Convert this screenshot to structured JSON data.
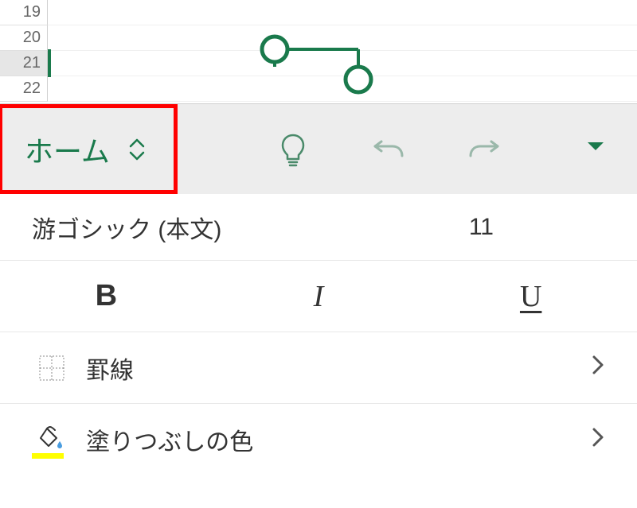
{
  "sheet": {
    "row_numbers": [
      "19",
      "20",
      "21",
      "22"
    ],
    "selected_row_index": 2
  },
  "toolbar": {
    "home_label": "ホーム",
    "icons": {
      "ideas": "lightbulb-icon",
      "undo": "undo-icon",
      "redo": "redo-icon",
      "expand": "dropdown-icon"
    }
  },
  "font": {
    "name": "游ゴシック (本文)",
    "size": "11"
  },
  "style_buttons": {
    "bold": "B",
    "italic": "I",
    "underline": "U"
  },
  "options": {
    "borders_label": "罫線",
    "fill_label": "塗りつぶしの色"
  },
  "colors": {
    "accent": "#1a7a4c",
    "highlight_box": "#ff0000",
    "fill_swatch": "#ffff00"
  }
}
